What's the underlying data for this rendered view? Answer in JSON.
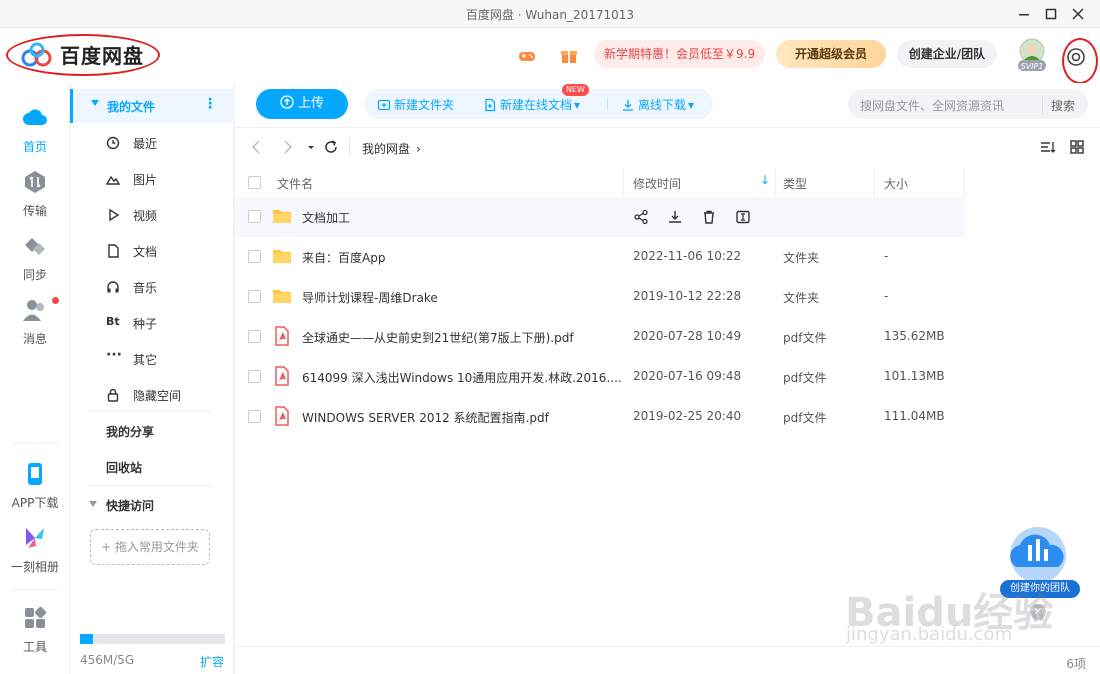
{
  "window": {
    "title": "百度网盘 · Wuhan_20171013"
  },
  "header": {
    "brand": "百度网盘",
    "promo": "新学期特惠！会员低至￥9.9",
    "vip_button": "开通超级会员",
    "enterprise_button": "创建企业/团队",
    "avatar_badge": "SVIP1"
  },
  "rail": {
    "items": [
      {
        "label": "首页"
      },
      {
        "label": "传输"
      },
      {
        "label": "同步"
      },
      {
        "label": "消息"
      },
      {
        "label": "APP下载"
      },
      {
        "label": "一刻相册"
      },
      {
        "label": "工具"
      }
    ]
  },
  "nav": {
    "my_files": "我的文件",
    "items": [
      {
        "label": "最近"
      },
      {
        "label": "图片"
      },
      {
        "label": "视频"
      },
      {
        "label": "文档"
      },
      {
        "label": "音乐"
      },
      {
        "label": "种子"
      },
      {
        "label": "其它"
      },
      {
        "label": "隐藏空间"
      }
    ],
    "bt_icon_text": "Bt",
    "my_share": "我的分享",
    "recycle": "回收站",
    "quick_access": "快捷访问",
    "drop_hint": "+ 拖入常用文件夹",
    "storage_text": "456M/5G",
    "storage_used_fraction": 0.09,
    "expand": "扩容"
  },
  "toolbar": {
    "upload": "上传",
    "new_folder": "新建文件夹",
    "new_online_doc": "新建在线文档",
    "new_badge": "NEW",
    "offline_download": "离线下载",
    "search_placeholder": "搜网盘文件、全网资源资讯",
    "search_button": "搜索"
  },
  "path": {
    "crumb": "我的网盘"
  },
  "table": {
    "headers": {
      "name": "文件名",
      "time": "修改时间",
      "type": "类型",
      "size": "大小"
    },
    "rows": [
      {
        "name": "文档加工",
        "time": "",
        "type": "",
        "size": "",
        "kind": "folder"
      },
      {
        "name": "来自：百度App",
        "time": "2022-11-06 10:22",
        "type": "文件夹",
        "size": "-",
        "kind": "folder"
      },
      {
        "name": "导师计划课程-周维Drake",
        "time": "2019-10-12 22:28",
        "type": "文件夹",
        "size": "-",
        "kind": "folder"
      },
      {
        "name": "全球通史——从史前史到21世纪(第7版上下册).pdf",
        "time": "2020-07-28 10:49",
        "type": "pdf文件",
        "size": "135.62MB",
        "kind": "pdf"
      },
      {
        "name": "614099 深入浅出Windows 10通用应用开发.林政.2016....",
        "time": "2020-07-16 09:48",
        "type": "pdf文件",
        "size": "101.13MB",
        "kind": "pdf"
      },
      {
        "name": "WINDOWS SERVER 2012 系统配置指南.pdf",
        "time": "2019-02-25 20:40",
        "type": "pdf文件",
        "size": "111.04MB",
        "kind": "pdf"
      }
    ]
  },
  "status": {
    "count": "6项"
  },
  "float": {
    "team_label": "创建你的团队"
  },
  "watermark": {
    "brand": "Baidu经验",
    "url": "jingyan.baidu.com"
  },
  "colors": {
    "accent": "#06a7ff",
    "folder": "#ffc53d",
    "pdf": "#f05a5a",
    "annotation": "#e02020"
  }
}
